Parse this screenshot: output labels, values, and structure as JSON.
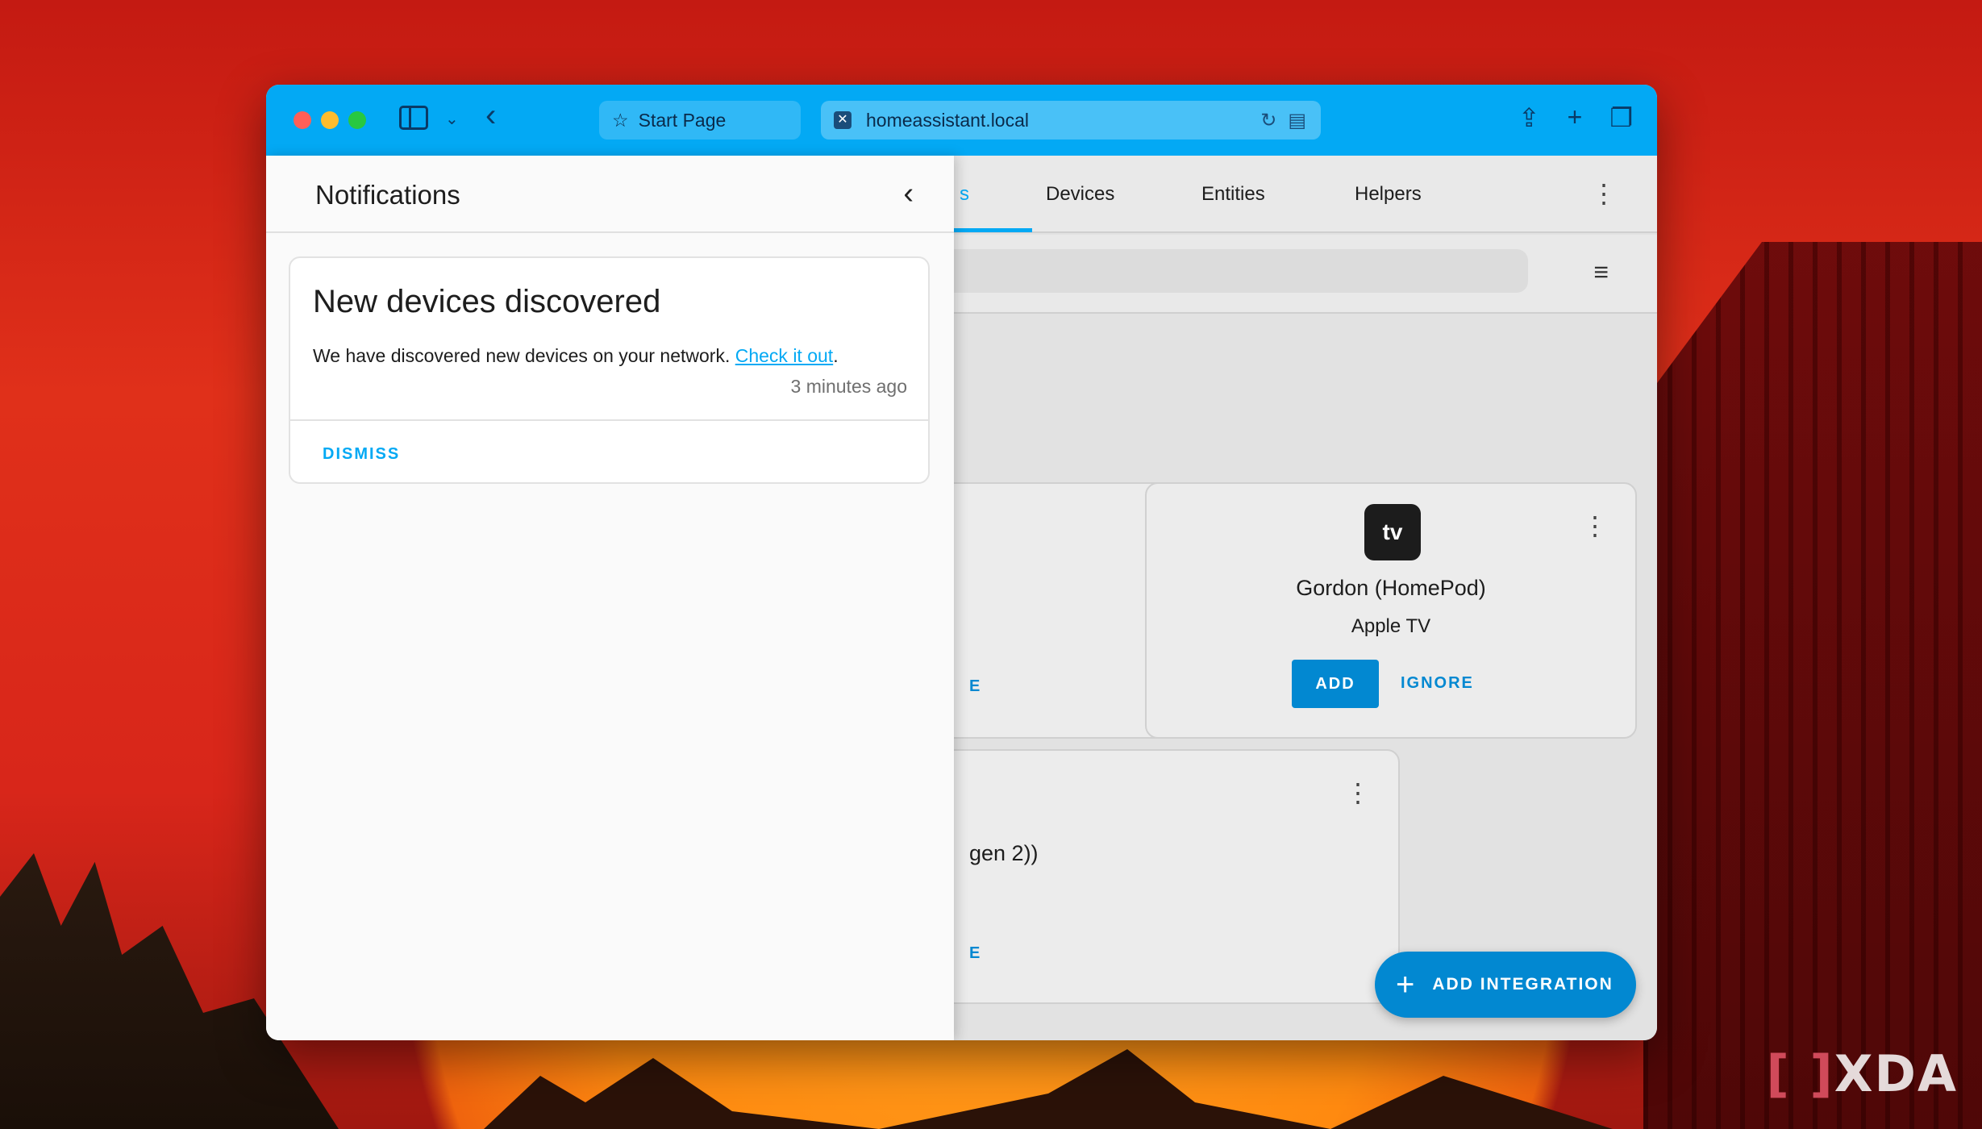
{
  "browser": {
    "back_icon": "chevron-left-icon",
    "tabs": [
      {
        "label": "Start Page",
        "icon": "star-icon"
      },
      {
        "label": "homeassistant.local",
        "icon": "favicon"
      }
    ],
    "toolbar_color": "#03a9f4"
  },
  "ha": {
    "active_tab_fragment": "s",
    "tabs": [
      "Devices",
      "Entities",
      "Helpers"
    ],
    "cards": [
      {
        "title": "Gordon (HomePod)",
        "subtitle": "Apple TV",
        "icon": "apple-tv-icon",
        "icon_label": "tv",
        "add_label": "ADD",
        "ignore_label": "IGNORE"
      },
      {
        "title_fragment": "gen 2))",
        "link_fragment": "E"
      }
    ],
    "card1_link_fragment": "E",
    "fab_label": "ADD INTEGRATION"
  },
  "notifications": {
    "title": "Notifications",
    "card": {
      "title": "New devices discovered",
      "message": "We have discovered new devices on your network.",
      "link_text": "Check it out",
      "message_end": ".",
      "time": "3 minutes ago",
      "dismiss_label": "DISMISS"
    }
  },
  "watermark": {
    "bracket": "[ ]",
    "text": "XDA"
  }
}
